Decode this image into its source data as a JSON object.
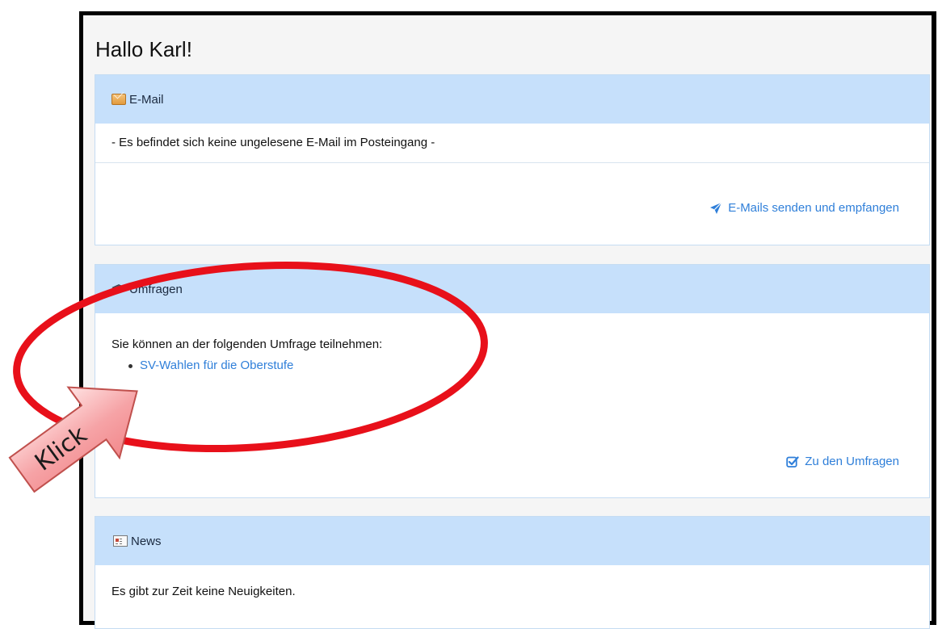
{
  "greeting": "Hallo Karl!",
  "email_panel": {
    "title": "E-Mail",
    "icon": "envelope-icon",
    "message": "- Es befindet sich keine ungelesene E-Mail im Posteingang -",
    "action_label": "E-Mails senden und empfangen",
    "action_icon": "paper-plane-icon"
  },
  "survey_panel": {
    "title": "Umfragen",
    "icon": "mortarboard-icon",
    "intro": "Sie können an der folgenden Umfrage teilnehmen:",
    "surveys": [
      "SV-Wahlen für die Oberstufe"
    ],
    "action_label": "Zu den Umfragen",
    "action_icon": "checkbox-edit-icon"
  },
  "news_panel": {
    "title": "News",
    "icon": "newspaper-icon",
    "message": "Es gibt zur Zeit keine Neuigkeiten."
  },
  "annotation": {
    "arrow_label": "Klick",
    "highlight_color": "#e8101a"
  },
  "colors": {
    "panel_header": "#c6e0fb",
    "link": "#2f7fd9"
  }
}
